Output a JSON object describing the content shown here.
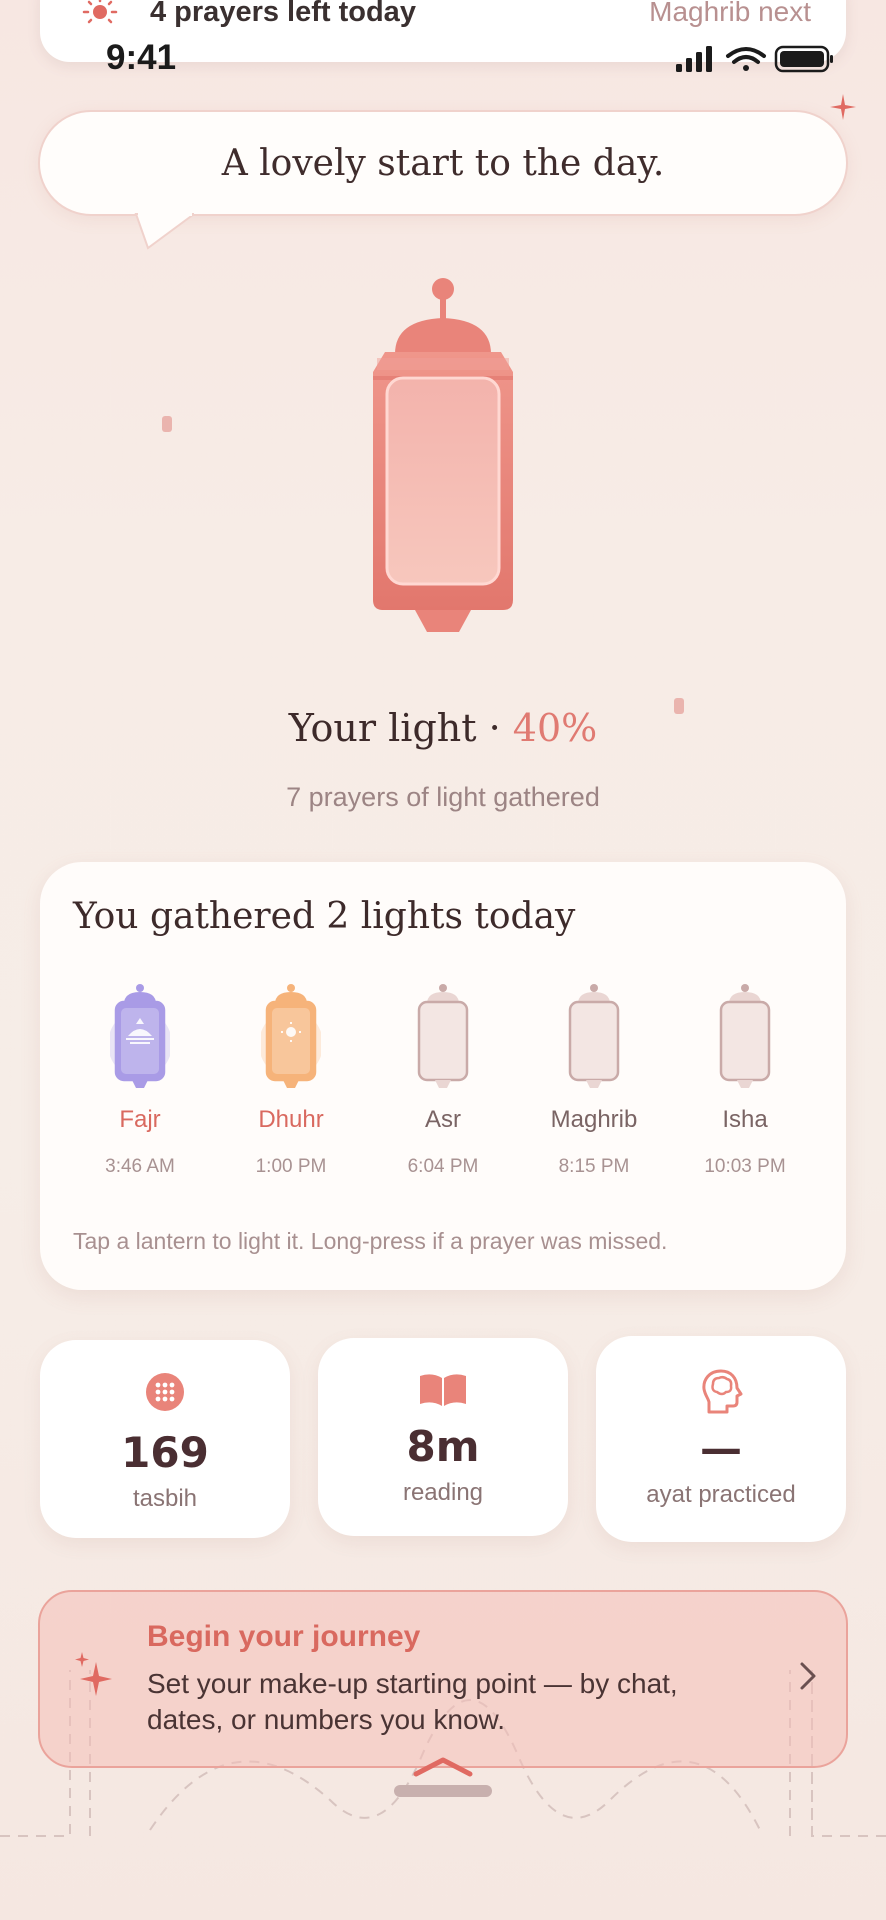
{
  "banner": {
    "icon": "sun-icon",
    "left_text": "4 prayers left today",
    "right_text": "Maghrib next"
  },
  "status_bar": {
    "time": "9:41"
  },
  "greeting": "A lovely start to the day.",
  "light": {
    "label": "Your light · ",
    "percent": "40%",
    "percent_value": 40,
    "subtitle": "7 prayers of light gathered"
  },
  "today": {
    "title": "You gathered 2 lights today",
    "prayers": [
      {
        "name": "Fajr",
        "time": "3:46 AM",
        "lit": true,
        "color": "#a99be6"
      },
      {
        "name": "Dhuhr",
        "time": "1:00 PM",
        "lit": true,
        "color": "#f6b37a"
      },
      {
        "name": "Asr",
        "time": "6:04 PM",
        "lit": false
      },
      {
        "name": "Maghrib",
        "time": "8:15 PM",
        "lit": false
      },
      {
        "name": "Isha",
        "time": "10:03 PM",
        "lit": false
      }
    ],
    "hint": "Tap a lantern to light it. Long-press if a prayer was missed."
  },
  "stats": [
    {
      "icon": "tasbih-grid-icon",
      "value": "169",
      "label": "tasbih"
    },
    {
      "icon": "open-book-icon",
      "value": "8m",
      "label": "reading"
    },
    {
      "icon": "brain-head-icon",
      "value": "—",
      "label": "ayat practiced"
    }
  ],
  "journey": {
    "title": "Begin your journey",
    "text": "Set your make-up starting point — by chat, dates, or numbers you know."
  },
  "colors": {
    "accent": "#e07a72",
    "lantern": "#e9847a"
  }
}
